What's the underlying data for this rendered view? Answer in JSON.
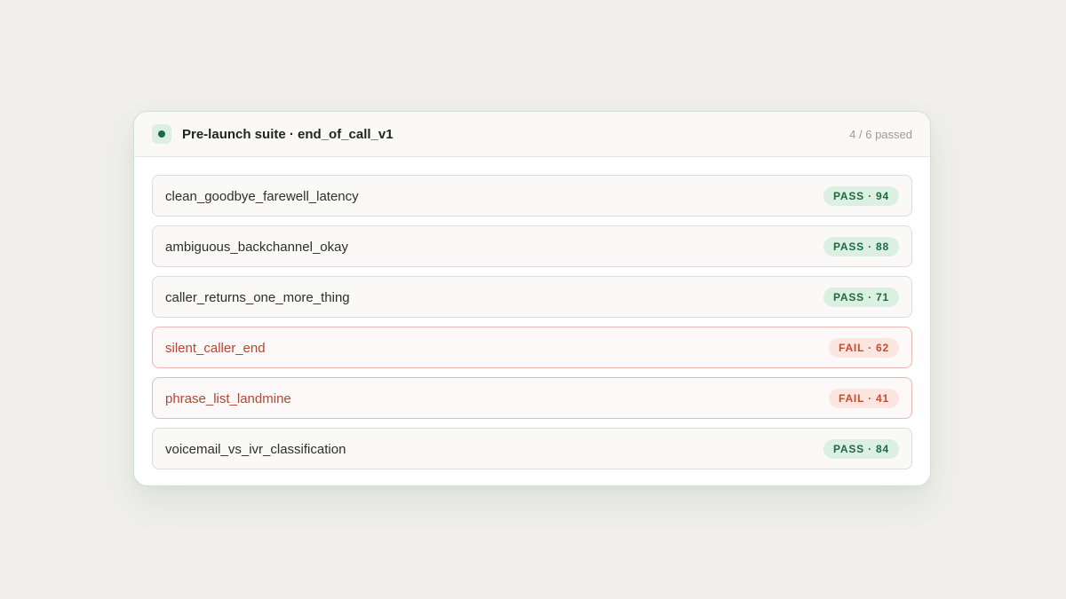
{
  "suite": {
    "title": "Pre-launch suite · end_of_call_v1",
    "summary": "4 / 6 passed",
    "accent_color": "#1b6b3f",
    "fail_color": "#c54a32"
  },
  "tests": [
    {
      "name": "clean_goodbye_farewell_latency",
      "badge": "PASS · 94",
      "status": "pass"
    },
    {
      "name": "ambiguous_backchannel_okay",
      "badge": "PASS · 88",
      "status": "pass"
    },
    {
      "name": "caller_returns_one_more_thing",
      "badge": "PASS · 71",
      "status": "pass"
    },
    {
      "name": "silent_caller_end",
      "badge": "FAIL · 62",
      "status": "fail"
    },
    {
      "name": "phrase_list_landmine",
      "badge": "FAIL · 41",
      "status": "fail"
    },
    {
      "name": "voicemail_vs_ivr_classification",
      "badge": "PASS · 84",
      "status": "pass"
    }
  ]
}
